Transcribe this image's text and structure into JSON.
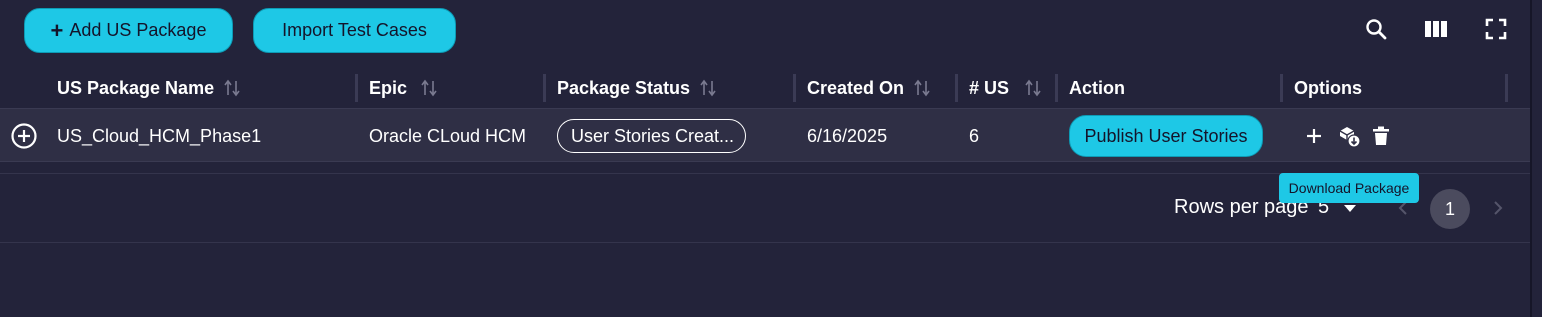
{
  "toolbar": {
    "add_package_label": "Add US Package",
    "import_label": "Import Test Cases",
    "icons": [
      "search-icon",
      "columns-icon",
      "fullscreen-icon"
    ]
  },
  "table": {
    "columns": [
      {
        "label": "US Package Name",
        "sortable": true
      },
      {
        "label": "Epic",
        "sortable": true
      },
      {
        "label": "Package Status",
        "sortable": true
      },
      {
        "label": "Created On",
        "sortable": true
      },
      {
        "label": "# US",
        "sortable": true
      },
      {
        "label": "Action",
        "sortable": false
      },
      {
        "label": "Options",
        "sortable": false
      }
    ],
    "rows": [
      {
        "name": "US_Cloud_HCM_Phase1",
        "epic": "Oracle CLoud HCM",
        "status": "User Stories Creat...",
        "created_on": "6/16/2025",
        "us_count": "6",
        "action_label": "Publish User Stories",
        "options": [
          "add-icon",
          "download-package-icon",
          "delete-icon"
        ]
      }
    ]
  },
  "tooltip": {
    "text": "Download Package"
  },
  "pagination": {
    "rows_per_page_label": "Rows per page",
    "rows_per_page_value": "5",
    "current_page": "1"
  },
  "colors": {
    "background": "#23233a",
    "row_background": "#2f2f45",
    "accent": "#1ec8e6",
    "page_indicator": "#4b4b5e"
  }
}
